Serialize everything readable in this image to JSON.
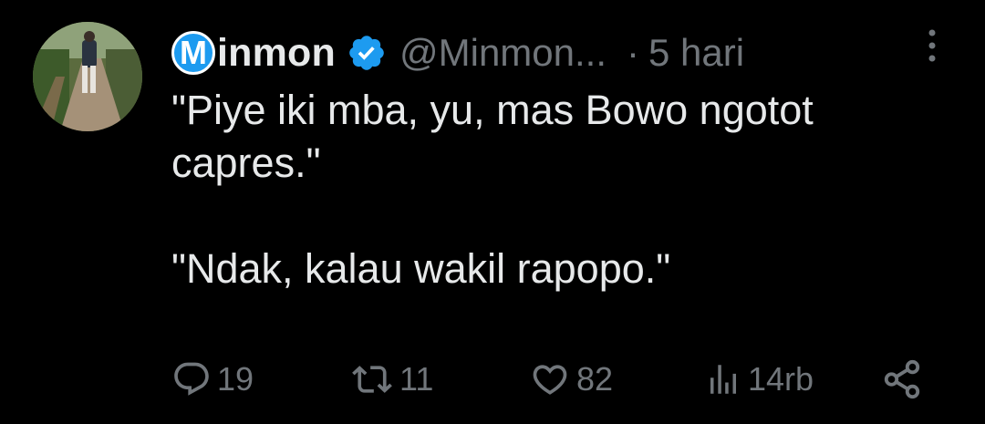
{
  "author": {
    "badge_letter": "M",
    "display_name": "inmon",
    "handle": "@Minmon...",
    "dot": "·",
    "time": "5 hari",
    "verified_icon": "verified-badge-icon",
    "accent_color": "#1d9bf0"
  },
  "tweet": {
    "text": "\"Piye iki mba, yu, mas Bowo ngotot\ncapres.\"\n\n\"Ndak, kalau wakil rapopo.\""
  },
  "actions": {
    "reply": {
      "icon": "reply-icon",
      "count": "19"
    },
    "retweet": {
      "icon": "retweet-icon",
      "count": "11"
    },
    "like": {
      "icon": "heart-icon",
      "count": "82"
    },
    "views": {
      "icon": "views-icon",
      "count": "14rb"
    },
    "share": {
      "icon": "share-icon"
    }
  },
  "menu": {
    "icon": "more-options-icon"
  }
}
